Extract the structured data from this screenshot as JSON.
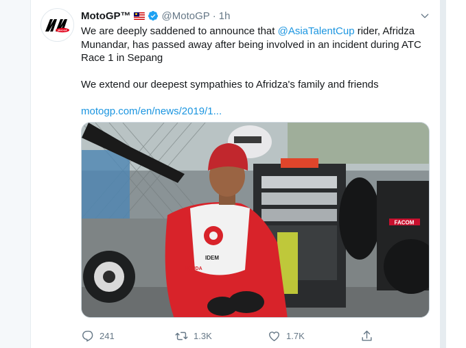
{
  "tweet": {
    "display_name": "MotoGP™",
    "handle": "@MotoGP",
    "separator": "·",
    "time": "1h",
    "text_part1": "We are deeply saddened to announce that ",
    "mention": "@AsiaTalentCup",
    "text_part2": " rider, Afridza Munandar, has passed away after being involved in an incident during ATC Race 1 in Sepang",
    "text_para2": "We extend our deepest sympathies to Afridza's family and friends",
    "link": "motogp.com/en/news/2019/1...",
    "avatar_logo": "motogp-logo",
    "media_image": "photo of rider in red racing leathers and red beanie crouching in pit lane",
    "media_text": {
      "facom": "FACOM",
      "leathers_brand": "IDEM",
      "leathers_logo": "HONDA"
    }
  },
  "actions": {
    "reply_count": "241",
    "retweet_count": "1.3K",
    "like_count": "1.7K"
  },
  "icons": {
    "flag": "malaysia-flag-icon",
    "verified": "verified-badge-icon",
    "caret": "chevron-down-icon",
    "reply": "reply-icon",
    "retweet": "retweet-icon",
    "like": "heart-icon",
    "share": "share-icon"
  },
  "colors": {
    "link": "#1b95e0",
    "text": "#14171a",
    "secondary": "#657786",
    "verified": "#1da1f2"
  }
}
